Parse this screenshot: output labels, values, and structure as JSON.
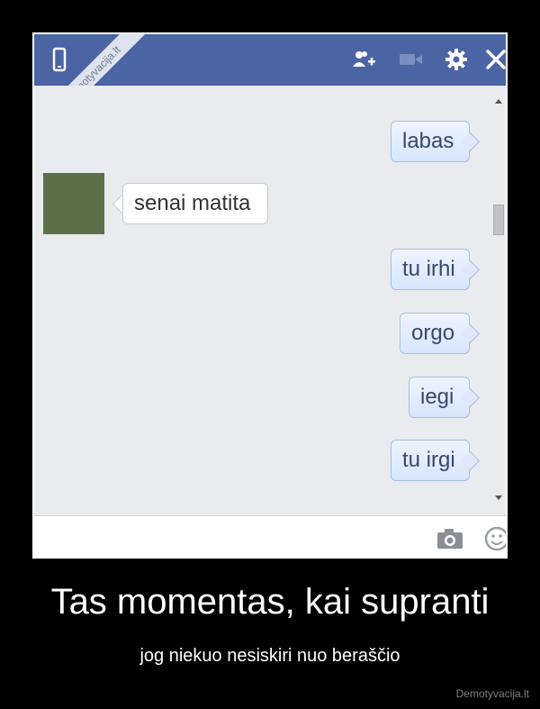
{
  "header": {
    "watermark": "Demotyvacija.lt"
  },
  "messages": [
    {
      "text": "labas",
      "side": "out"
    },
    {
      "text": "senai matita",
      "side": "in"
    },
    {
      "text": "tu irhi",
      "side": "out"
    },
    {
      "text": "orgo",
      "side": "out"
    },
    {
      "text": "iegi",
      "side": "out"
    },
    {
      "text": "tu irgi",
      "side": "out"
    }
  ],
  "caption": {
    "title": "Tas momentas, kai supranti",
    "subtitle": "jog niekuo nesiskiri nuo beraščio"
  },
  "footer": {
    "watermark": "Demotyvacija.lt"
  },
  "colors": {
    "header_bg": "#4b64a3",
    "chat_bg": "#e9ebee",
    "avatar": "#5b7049",
    "page_bg": "#000000"
  },
  "icons": [
    "mobile-icon",
    "add-friend-icon",
    "video-call-icon",
    "settings-icon",
    "close-icon",
    "camera-icon",
    "emoji-icon"
  ]
}
